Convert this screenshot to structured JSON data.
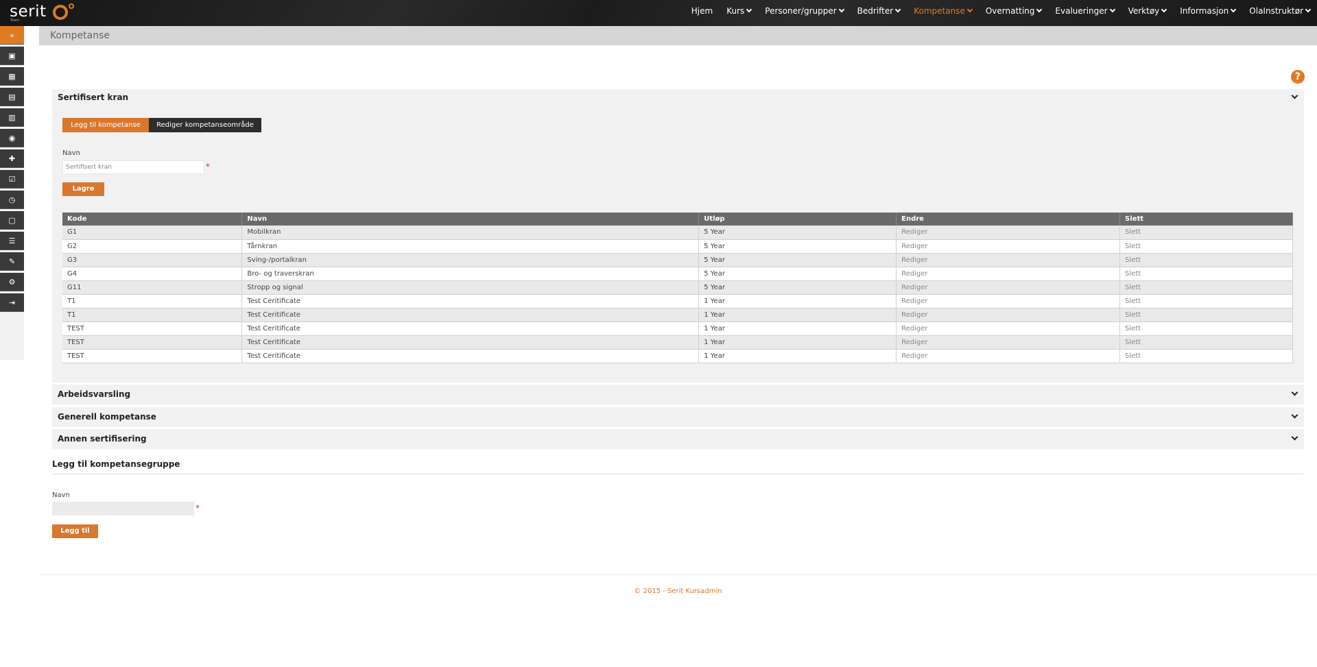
{
  "app": {
    "logo_text": "serit",
    "logo_sub": "Team"
  },
  "colors": {
    "accent": "#e07b21",
    "topbar": "#1a1a1a",
    "dark_button": "#2d2d2d"
  },
  "nav": {
    "items": [
      {
        "label": "Hjem",
        "dropdown": false,
        "active": false
      },
      {
        "label": "Kurs",
        "dropdown": true,
        "active": false
      },
      {
        "label": "Personer/grupper",
        "dropdown": true,
        "active": false
      },
      {
        "label": "Bedrifter",
        "dropdown": true,
        "active": false
      },
      {
        "label": "Kompetanse",
        "dropdown": true,
        "active": true
      },
      {
        "label": "Overnatting",
        "dropdown": true,
        "active": false
      },
      {
        "label": "Evalueringer",
        "dropdown": true,
        "active": false
      },
      {
        "label": "Verktøy",
        "dropdown": true,
        "active": false
      },
      {
        "label": "Informasjon",
        "dropdown": true,
        "active": false
      },
      {
        "label": "OlaInstruktør",
        "dropdown": true,
        "active": false
      }
    ]
  },
  "sidebar": {
    "icons": [
      "expand-icon",
      "calendar-icon",
      "calendar-grid-icon",
      "book-icon",
      "book-stack-icon",
      "person-search-icon",
      "add-user-icon",
      "checkbox-icon",
      "clock-icon",
      "document-icon",
      "document-list-icon",
      "document-edit-icon",
      "gear-icon",
      "logout-icon"
    ]
  },
  "page": {
    "title": "Kompetanse",
    "help": "?"
  },
  "section1": {
    "title": "Sertifisert kran",
    "add_button": "Legg til kompetanse",
    "edit_button": "Rediger kompetanseområde",
    "name_label": "Navn",
    "name_value": "Sertifisert kran",
    "required_mark": "*",
    "save_button": "Lagre",
    "table": {
      "headers": [
        "Kode",
        "Navn",
        "Utløp",
        "Endre",
        "Slett"
      ],
      "rows": [
        [
          "G1",
          "Mobilkran",
          "5 Year",
          "Rediger",
          "Slett"
        ],
        [
          "G2",
          "Tårnkran",
          "5 Year",
          "Rediger",
          "Slett"
        ],
        [
          "G3",
          "Sving-/portalkran",
          "5 Year",
          "Rediger",
          "Slett"
        ],
        [
          "G4",
          "Bro- og traverskran",
          "5 Year",
          "Rediger",
          "Slett"
        ],
        [
          "G11",
          "Stropp og signal",
          "5 Year",
          "Rediger",
          "Slett"
        ],
        [
          "T1",
          "Test Ceritificate",
          "1 Year",
          "Rediger",
          "Slett"
        ],
        [
          "T1",
          "Test Ceritificate",
          "1 Year",
          "Rediger",
          "Slett"
        ],
        [
          "TEST",
          "Test Ceritificate",
          "1 Year",
          "Rediger",
          "Slett"
        ],
        [
          "TEST",
          "Test Ceritificate",
          "1 Year",
          "Rediger",
          "Slett"
        ],
        [
          "TEST",
          "Test Ceritificate",
          "1 Year",
          "Rediger",
          "Slett"
        ]
      ]
    }
  },
  "collapsed_sections": [
    {
      "title": "Arbeidsvarsling"
    },
    {
      "title": "Generell kompetanse"
    },
    {
      "title": "Annen sertifisering"
    }
  ],
  "add_group": {
    "title": "Legg til kompetansegruppe",
    "name_label": "Navn",
    "name_value": "",
    "required_mark": "*",
    "add_button": "Legg til"
  },
  "footer": {
    "text": "© 2015 - Serit Kursadmin"
  }
}
